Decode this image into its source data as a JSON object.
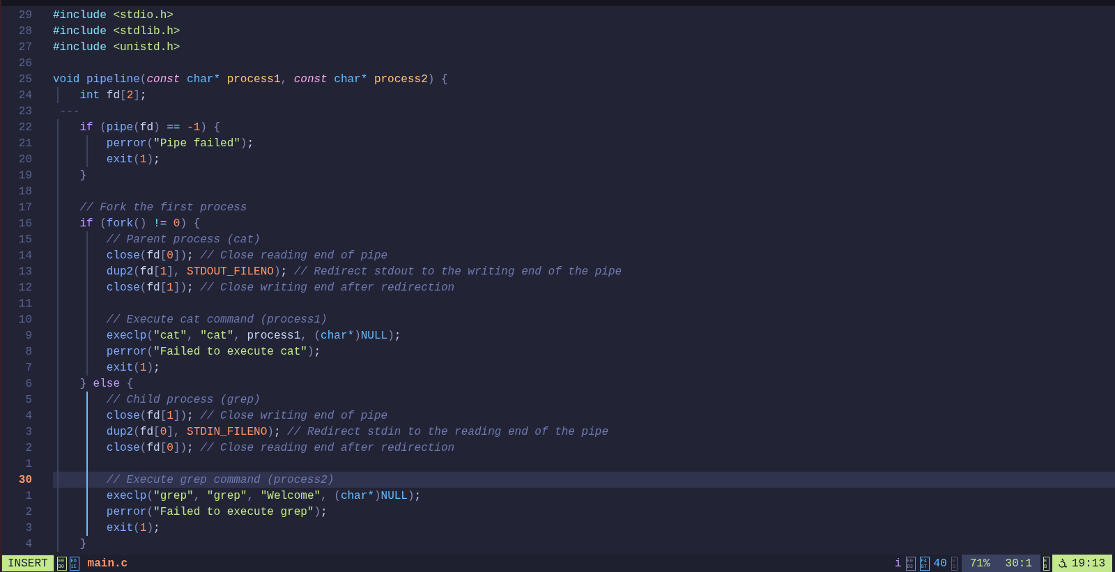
{
  "editor": {
    "lines": [
      {
        "number": "29",
        "current": false,
        "tokens": [
          {
            "kind": "pp",
            "text": "#include"
          },
          {
            "kind": "str",
            "text": " <stdio.h>"
          }
        ]
      },
      {
        "number": "28",
        "current": false,
        "tokens": [
          {
            "kind": "pp",
            "text": "#include"
          },
          {
            "kind": "str",
            "text": " <stdlib.h>"
          }
        ]
      },
      {
        "number": "27",
        "current": false,
        "tokens": [
          {
            "kind": "pp",
            "text": "#include"
          },
          {
            "kind": "str",
            "text": " <unistd.h>"
          }
        ]
      },
      {
        "number": "26",
        "current": false
      },
      {
        "number": "25",
        "current": false,
        "tokens": [
          {
            "kind": "type",
            "text": "void"
          },
          {
            "kind": "fn",
            "text": " pipeline"
          },
          {
            "kind": "punct",
            "text": "("
          },
          {
            "kind": "kwi",
            "text": "const"
          },
          {
            "kind": "type",
            "text": " char*"
          },
          {
            "kind": "param",
            "text": " process1"
          },
          {
            "kind": "punct",
            "text": ","
          },
          {
            "kind": "kwi",
            "text": " const"
          },
          {
            "kind": "type",
            "text": " char*"
          },
          {
            "kind": "param",
            "text": " process2"
          },
          {
            "kind": "punct",
            "text": ")"
          },
          {
            "kind": "punct",
            "text": " {"
          }
        ]
      },
      {
        "number": "24",
        "current": false,
        "guides": [
          {
            "active": false
          }
        ],
        "tokens": [
          {
            "kind": "type",
            "text": "    int"
          },
          {
            "kind": "plain",
            "text": " fd"
          },
          {
            "kind": "punct",
            "text": "["
          },
          {
            "kind": "num",
            "text": "2"
          },
          {
            "kind": "punct",
            "text": "]"
          },
          {
            "kind": "plain",
            "text": ";"
          }
        ]
      },
      {
        "number": "23",
        "current": false,
        "tokens": [
          {
            "kind": "dim",
            "text": " ---"
          }
        ]
      },
      {
        "number": "22",
        "current": false,
        "guides": [
          {
            "active": false
          }
        ],
        "tokens": [
          {
            "kind": "kw",
            "text": "    if"
          },
          {
            "kind": "punct",
            "text": " ("
          },
          {
            "kind": "fn",
            "text": "pipe"
          },
          {
            "kind": "punct",
            "text": "("
          },
          {
            "kind": "plain",
            "text": "fd"
          },
          {
            "kind": "punct",
            "text": ")"
          },
          {
            "kind": "op",
            "text": " =="
          },
          {
            "kind": "num",
            "text": " -1"
          },
          {
            "kind": "punct",
            "text": ")"
          },
          {
            "kind": "punct",
            "text": " {"
          }
        ]
      },
      {
        "number": "21",
        "current": false,
        "guides": [
          {
            "active": false
          },
          {
            "active": false
          }
        ],
        "tokens": [
          {
            "kind": "fn",
            "text": "        perror"
          },
          {
            "kind": "punct",
            "text": "("
          },
          {
            "kind": "str",
            "text": "\"Pipe failed\""
          },
          {
            "kind": "punct",
            "text": ")"
          },
          {
            "kind": "plain",
            "text": ";"
          }
        ]
      },
      {
        "number": "20",
        "current": false,
        "guides": [
          {
            "active": false
          },
          {
            "active": false
          }
        ],
        "tokens": [
          {
            "kind": "fn",
            "text": "        exit"
          },
          {
            "kind": "punct",
            "text": "("
          },
          {
            "kind": "num",
            "text": "1"
          },
          {
            "kind": "punct",
            "text": ")"
          },
          {
            "kind": "plain",
            "text": ";"
          }
        ]
      },
      {
        "number": "19",
        "current": false,
        "guides": [
          {
            "active": false
          }
        ],
        "tokens": [
          {
            "kind": "punct",
            "text": "    }"
          }
        ]
      },
      {
        "number": "18",
        "current": false,
        "guides": [
          {
            "active": false
          }
        ]
      },
      {
        "number": "17",
        "current": false,
        "guides": [
          {
            "active": false
          }
        ],
        "tokens": [
          {
            "kind": "com",
            "text": "    // Fork the first process"
          }
        ]
      },
      {
        "number": "16",
        "current": false,
        "guides": [
          {
            "active": false
          }
        ],
        "tokens": [
          {
            "kind": "kw",
            "text": "    if"
          },
          {
            "kind": "punct",
            "text": " ("
          },
          {
            "kind": "fn",
            "text": "fork"
          },
          {
            "kind": "punct",
            "text": "()"
          },
          {
            "kind": "op",
            "text": " !="
          },
          {
            "kind": "num",
            "text": " 0"
          },
          {
            "kind": "punct",
            "text": ")"
          },
          {
            "kind": "punct",
            "text": " {"
          }
        ]
      },
      {
        "number": "15",
        "current": false,
        "guides": [
          {
            "active": false
          },
          {
            "active": false
          }
        ],
        "tokens": [
          {
            "kind": "com",
            "text": "        // Parent process (cat)"
          }
        ]
      },
      {
        "number": "14",
        "current": false,
        "guides": [
          {
            "active": false
          },
          {
            "active": false
          }
        ],
        "tokens": [
          {
            "kind": "fn",
            "text": "        close"
          },
          {
            "kind": "punct",
            "text": "("
          },
          {
            "kind": "plain",
            "text": "fd"
          },
          {
            "kind": "punct",
            "text": "["
          },
          {
            "kind": "num",
            "text": "0"
          },
          {
            "kind": "punct",
            "text": "])"
          },
          {
            "kind": "plain",
            "text": ";"
          },
          {
            "kind": "com",
            "text": " // Close reading end of pipe"
          }
        ]
      },
      {
        "number": "13",
        "current": false,
        "guides": [
          {
            "active": false
          },
          {
            "active": false
          }
        ],
        "tokens": [
          {
            "kind": "fn",
            "text": "        dup2"
          },
          {
            "kind": "punct",
            "text": "("
          },
          {
            "kind": "plain",
            "text": "fd"
          },
          {
            "kind": "punct",
            "text": "["
          },
          {
            "kind": "num",
            "text": "1"
          },
          {
            "kind": "punct",
            "text": "],"
          },
          {
            "kind": "const",
            "text": " STDOUT_FILENO"
          },
          {
            "kind": "punct",
            "text": ")"
          },
          {
            "kind": "plain",
            "text": ";"
          },
          {
            "kind": "com",
            "text": " // Redirect stdout to the writing end of the pipe"
          }
        ]
      },
      {
        "number": "12",
        "current": false,
        "guides": [
          {
            "active": false
          },
          {
            "active": false
          }
        ],
        "tokens": [
          {
            "kind": "fn",
            "text": "        close"
          },
          {
            "kind": "punct",
            "text": "("
          },
          {
            "kind": "plain",
            "text": "fd"
          },
          {
            "kind": "punct",
            "text": "["
          },
          {
            "kind": "num",
            "text": "1"
          },
          {
            "kind": "punct",
            "text": "])"
          },
          {
            "kind": "plain",
            "text": ";"
          },
          {
            "kind": "com",
            "text": " // Close writing end after redirection"
          }
        ]
      },
      {
        "number": "11",
        "current": false,
        "guides": [
          {
            "active": false
          },
          {
            "active": false
          }
        ]
      },
      {
        "number": "10",
        "current": false,
        "guides": [
          {
            "active": false
          },
          {
            "active": false
          }
        ],
        "tokens": [
          {
            "kind": "com",
            "text": "        // Execute cat command (process1)"
          }
        ]
      },
      {
        "number": "9",
        "current": false,
        "guides": [
          {
            "active": false
          },
          {
            "active": false
          }
        ],
        "tokens": [
          {
            "kind": "fn",
            "text": "        execlp"
          },
          {
            "kind": "punct",
            "text": "("
          },
          {
            "kind": "str",
            "text": "\"cat\""
          },
          {
            "kind": "punct",
            "text": ","
          },
          {
            "kind": "str",
            "text": " \"cat\""
          },
          {
            "kind": "punct",
            "text": ","
          },
          {
            "kind": "plain",
            "text": " process1"
          },
          {
            "kind": "punct",
            "text": ","
          },
          {
            "kind": "punct",
            "text": " ("
          },
          {
            "kind": "type",
            "text": "char*"
          },
          {
            "kind": "punct",
            "text": ")"
          },
          {
            "kind": "type",
            "text": "NULL"
          },
          {
            "kind": "punct",
            "text": ")"
          },
          {
            "kind": "plain",
            "text": ";"
          }
        ]
      },
      {
        "number": "8",
        "current": false,
        "guides": [
          {
            "active": false
          },
          {
            "active": false
          }
        ],
        "tokens": [
          {
            "kind": "fn",
            "text": "        perror"
          },
          {
            "kind": "punct",
            "text": "("
          },
          {
            "kind": "str",
            "text": "\"Failed to execute cat\""
          },
          {
            "kind": "punct",
            "text": ")"
          },
          {
            "kind": "plain",
            "text": ";"
          }
        ]
      },
      {
        "number": "7",
        "current": false,
        "guides": [
          {
            "active": false
          },
          {
            "active": false
          }
        ],
        "tokens": [
          {
            "kind": "fn",
            "text": "        exit"
          },
          {
            "kind": "punct",
            "text": "("
          },
          {
            "kind": "num",
            "text": "1"
          },
          {
            "kind": "punct",
            "text": ")"
          },
          {
            "kind": "plain",
            "text": ";"
          }
        ]
      },
      {
        "number": "6",
        "current": false,
        "guides": [
          {
            "active": false
          }
        ],
        "tokens": [
          {
            "kind": "punct",
            "text": "    }"
          },
          {
            "kind": "kw",
            "text": " else"
          },
          {
            "kind": "punct",
            "text": " {"
          }
        ]
      },
      {
        "number": "5",
        "current": false,
        "guides": [
          {
            "active": false
          },
          {
            "active": true
          }
        ],
        "tokens": [
          {
            "kind": "com",
            "text": "        // Child process (grep)"
          }
        ]
      },
      {
        "number": "4",
        "current": false,
        "guides": [
          {
            "active": false
          },
          {
            "active": true
          }
        ],
        "tokens": [
          {
            "kind": "fn",
            "text": "        close"
          },
          {
            "kind": "punct",
            "text": "("
          },
          {
            "kind": "plain",
            "text": "fd"
          },
          {
            "kind": "punct",
            "text": "["
          },
          {
            "kind": "num",
            "text": "1"
          },
          {
            "kind": "punct",
            "text": "])"
          },
          {
            "kind": "plain",
            "text": ";"
          },
          {
            "kind": "com",
            "text": " // Close writing end of pipe"
          }
        ]
      },
      {
        "number": "3",
        "current": false,
        "guides": [
          {
            "active": false
          },
          {
            "active": true
          }
        ],
        "tokens": [
          {
            "kind": "fn",
            "text": "        dup2"
          },
          {
            "kind": "punct",
            "text": "("
          },
          {
            "kind": "plain",
            "text": "fd"
          },
          {
            "kind": "punct",
            "text": "["
          },
          {
            "kind": "num",
            "text": "0"
          },
          {
            "kind": "punct",
            "text": "],"
          },
          {
            "kind": "const",
            "text": " STDIN_FILENO"
          },
          {
            "kind": "punct",
            "text": ")"
          },
          {
            "kind": "plain",
            "text": ";"
          },
          {
            "kind": "com",
            "text": " // Redirect stdin to the reading end of the pipe"
          }
        ]
      },
      {
        "number": "2",
        "current": false,
        "guides": [
          {
            "active": false
          },
          {
            "active": true
          }
        ],
        "tokens": [
          {
            "kind": "fn",
            "text": "        close"
          },
          {
            "kind": "punct",
            "text": "("
          },
          {
            "kind": "plain",
            "text": "fd"
          },
          {
            "kind": "punct",
            "text": "["
          },
          {
            "kind": "num",
            "text": "0"
          },
          {
            "kind": "punct",
            "text": "])"
          },
          {
            "kind": "plain",
            "text": ";"
          },
          {
            "kind": "com",
            "text": " // Close reading end after redirection"
          }
        ]
      },
      {
        "number": "1",
        "current": false,
        "guides": [
          {
            "active": false
          },
          {
            "active": true
          }
        ]
      },
      {
        "number": "30",
        "current": true,
        "guides": [
          {
            "active": false
          },
          {
            "active": true
          }
        ],
        "tokens": [
          {
            "kind": "com",
            "text": "        // Execute grep command (process2)"
          }
        ]
      },
      {
        "number": "1",
        "current": false,
        "guides": [
          {
            "active": false
          },
          {
            "active": true
          }
        ],
        "tokens": [
          {
            "kind": "fn",
            "text": "        execlp"
          },
          {
            "kind": "punct",
            "text": "("
          },
          {
            "kind": "str",
            "text": "\"grep\""
          },
          {
            "kind": "punct",
            "text": ","
          },
          {
            "kind": "str",
            "text": " \"grep\""
          },
          {
            "kind": "punct",
            "text": ","
          },
          {
            "kind": "str",
            "text": " \"Welcome\""
          },
          {
            "kind": "punct",
            "text": ","
          },
          {
            "kind": "punct",
            "text": " ("
          },
          {
            "kind": "type",
            "text": "char*"
          },
          {
            "kind": "punct",
            "text": ")"
          },
          {
            "kind": "type",
            "text": "NULL"
          },
          {
            "kind": "punct",
            "text": ")"
          },
          {
            "kind": "plain",
            "text": ";"
          }
        ]
      },
      {
        "number": "2",
        "current": false,
        "guides": [
          {
            "active": false
          },
          {
            "active": true
          }
        ],
        "tokens": [
          {
            "kind": "fn",
            "text": "        perror"
          },
          {
            "kind": "punct",
            "text": "("
          },
          {
            "kind": "str",
            "text": "\"Failed to execute grep\""
          },
          {
            "kind": "punct",
            "text": ")"
          },
          {
            "kind": "plain",
            "text": ";"
          }
        ]
      },
      {
        "number": "3",
        "current": false,
        "guides": [
          {
            "active": false
          },
          {
            "active": true
          }
        ],
        "tokens": [
          {
            "kind": "fn",
            "text": "        exit"
          },
          {
            "kind": "punct",
            "text": "("
          },
          {
            "kind": "num",
            "text": "1"
          },
          {
            "kind": "punct",
            "text": ")"
          },
          {
            "kind": "plain",
            "text": ";"
          }
        ]
      },
      {
        "number": "4",
        "current": false,
        "guides": [
          {
            "active": false
          }
        ],
        "tokens": [
          {
            "kind": "punct",
            "text": "    }"
          }
        ]
      }
    ]
  },
  "status_bar": {
    "mode": "INSERT",
    "left_glyphs": [
      {
        "text": "E0B0",
        "color": "#c3e88d"
      },
      {
        "text": "E61E",
        "color": "#65bcff"
      }
    ],
    "file": "main.c",
    "right": [
      {
        "kind": "label",
        "text": "i",
        "color": "#c099ff"
      },
      {
        "kind": "glyph",
        "text": "E0B3",
        "color": "#828bb8"
      },
      {
        "kind": "glyph",
        "text": "F487",
        "color": "#65bcff"
      },
      {
        "kind": "label",
        "text": "40",
        "color": "#65bcff"
      },
      {
        "kind": "glyph",
        "text": "EB",
        "color": "#545c7e"
      }
    ],
    "progress": "71%",
    "position": "30:1",
    "clock_glyph": "EB",
    "time": "19:13"
  }
}
